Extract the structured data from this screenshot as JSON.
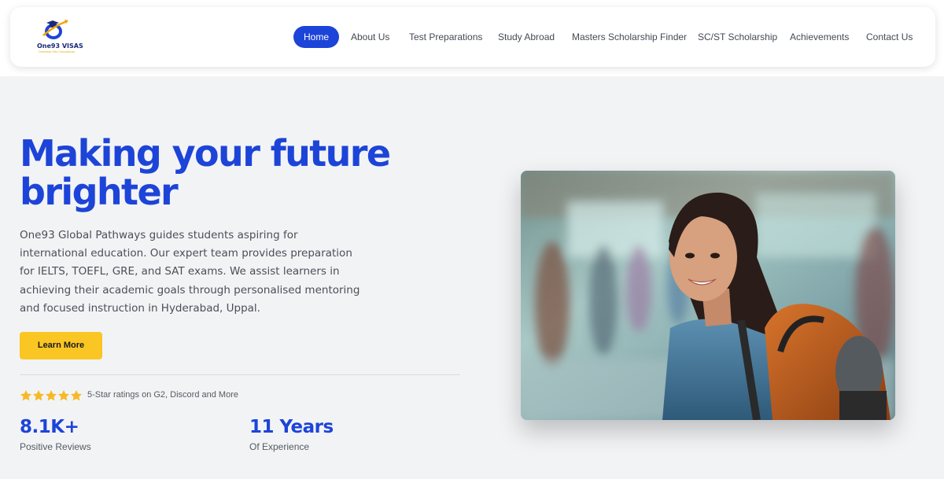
{
  "brand": {
    "name": "One93 VISAS",
    "tagline": "Overseas Edu Consultants",
    "logo_icon": "graduation-cap-globe-icon",
    "primary_color": "#1d44d8",
    "accent_color": "#f9c623"
  },
  "nav": {
    "items": [
      {
        "label": "Home",
        "active": true
      },
      {
        "label": "About Us"
      },
      {
        "label": "Test Preparations"
      },
      {
        "label": "Study Abroad"
      },
      {
        "label": "Masters Scholarship Finder"
      },
      {
        "label": "SC/ST Scholarship"
      },
      {
        "label": "Achievements"
      },
      {
        "label": "Contact Us"
      }
    ]
  },
  "hero": {
    "title": "Making your future brighter",
    "description": "One93 Global Pathways guides students aspiring for international education. Our expert team provides preparation for IELTS, TOEFL, GRE, and SAT exams. We assist learners in achieving their academic goals through personalised mentoring and focused instruction in Hyderabad, Uppal.",
    "cta_label": "Learn More",
    "rating": {
      "stars": 5,
      "text": "5-Star ratings on G2, Discord and More"
    },
    "stats": [
      {
        "value": "8.1K+",
        "label": "Positive Reviews"
      },
      {
        "value": "11 Years",
        "label": "Of Experience"
      }
    ],
    "image_icon": "student-with-backpack-photo"
  }
}
